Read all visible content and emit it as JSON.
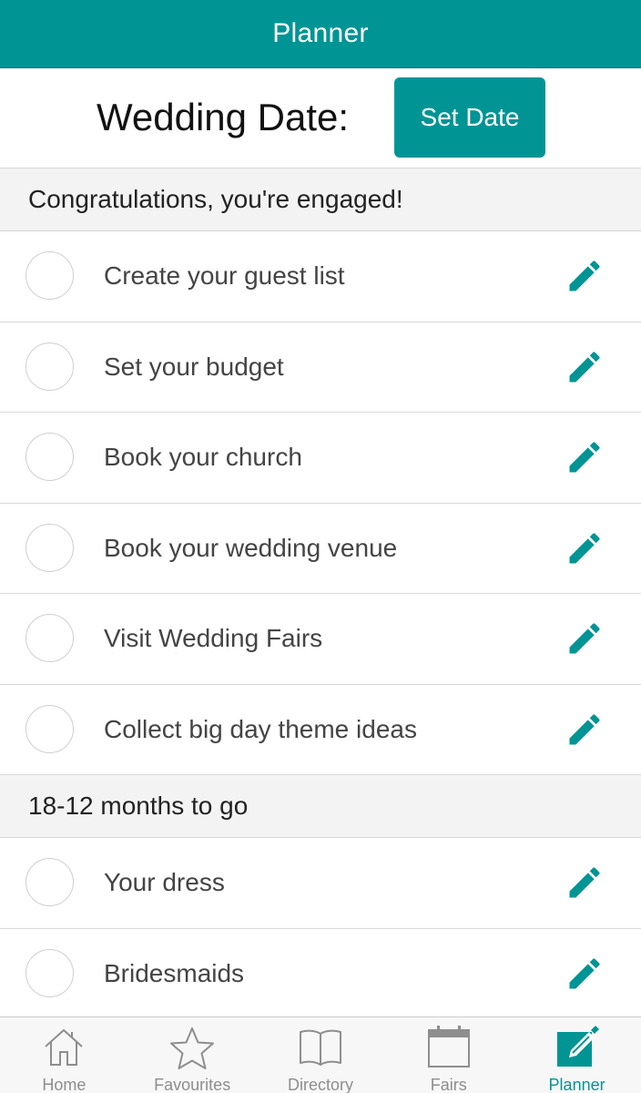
{
  "header": {
    "title": "Planner"
  },
  "wedding": {
    "label": "Wedding Date:",
    "set_date_label": "Set Date"
  },
  "sections": [
    {
      "title": "Congratulations, you're engaged!",
      "tasks": [
        "Create your guest list",
        "Set your budget",
        "Book your church",
        "Book your wedding venue",
        "Visit Wedding Fairs",
        "Collect big day theme ideas"
      ]
    },
    {
      "title": "18-12 months to go",
      "tasks": [
        "Your dress",
        "Bridesmaids"
      ]
    }
  ],
  "tabbar": {
    "items": [
      {
        "label": "Home",
        "icon": "home-icon"
      },
      {
        "label": "Favourites",
        "icon": "star-icon"
      },
      {
        "label": "Directory",
        "icon": "book-icon"
      },
      {
        "label": "Fairs",
        "icon": "calendar-icon"
      },
      {
        "label": "Planner",
        "icon": "edit-square-icon"
      }
    ],
    "active": "Planner"
  },
  "colors": {
    "accent": "#009494",
    "inactive": "#8e8e8e",
    "section_bg": "#f3f3f3"
  }
}
